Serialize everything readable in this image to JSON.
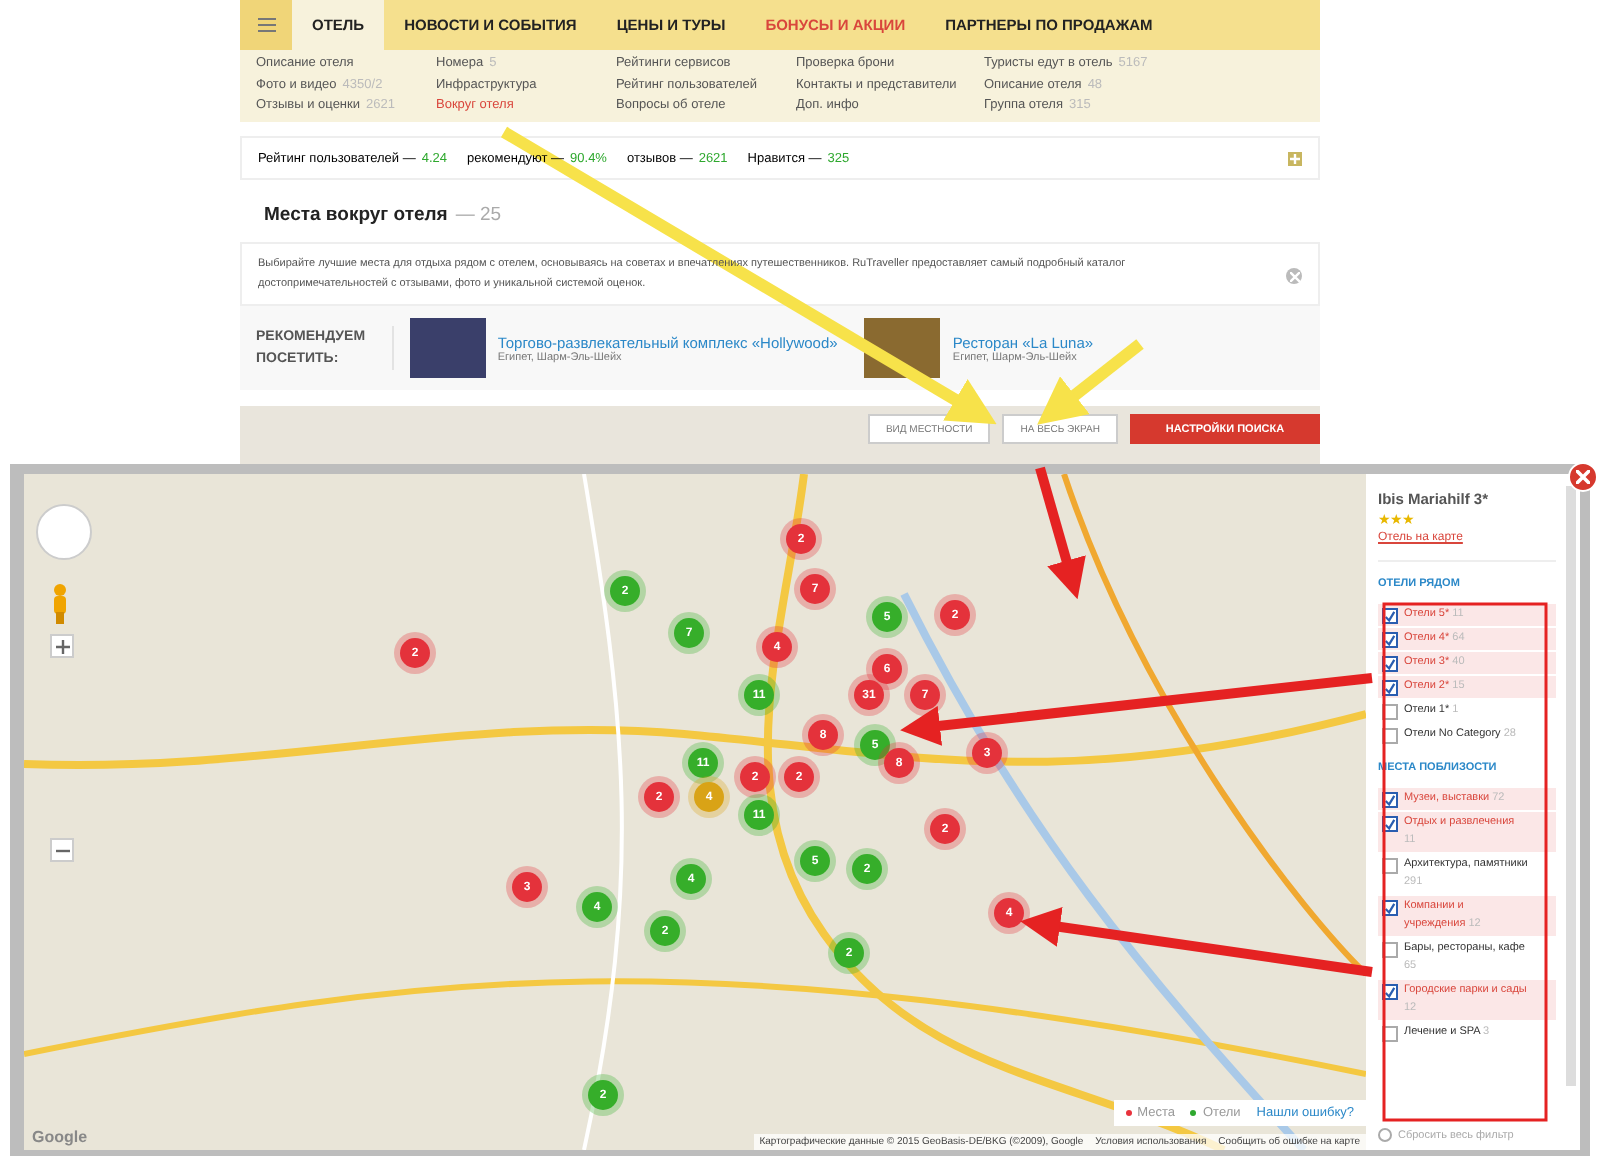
{
  "nav": {
    "tabs": [
      {
        "label": "ОТЕЛЬ",
        "selected": true,
        "kind": "normal"
      },
      {
        "label": "НОВОСТИ И СОБЫТИЯ",
        "selected": false,
        "kind": "normal"
      },
      {
        "label": "ЦЕНЫ И ТУРЫ",
        "selected": false,
        "kind": "normal"
      },
      {
        "label": "БОНУСЫ И АКЦИИ",
        "selected": false,
        "kind": "promo"
      },
      {
        "label": "ПАРТНЕРЫ ПО ПРОДАЖАМ",
        "selected": false,
        "kind": "normal"
      }
    ]
  },
  "submenu": {
    "columns": [
      [
        {
          "label": "Описание отеля",
          "selected": false
        },
        {
          "label": "Фото и видео",
          "count": "4350/2",
          "selected": false
        },
        {
          "label": "Отзывы и оценки",
          "count": "2621",
          "selected": false
        }
      ],
      [
        {
          "label": "Номера",
          "count": "5",
          "selected": false
        },
        {
          "label": "Инфраструктура",
          "selected": false
        },
        {
          "label": "Вокруг отеля",
          "selected": true
        }
      ],
      [
        {
          "label": "Рейтинги сервисов",
          "selected": false
        },
        {
          "label": "Рейтинг пользователей",
          "selected": false
        },
        {
          "label": "Вопросы об отеле",
          "selected": false
        }
      ],
      [
        {
          "label": "Проверка брони",
          "selected": false
        },
        {
          "label": "Контакты и представители",
          "selected": false
        },
        {
          "label": "Доп. инфо",
          "selected": false
        }
      ],
      [
        {
          "label": "Туристы едут в отель",
          "count": "5167",
          "selected": false
        },
        {
          "label": "Описание отеля",
          "count": "48",
          "selected": false
        },
        {
          "label": "Группа отеля",
          "count": "315",
          "selected": false
        }
      ]
    ]
  },
  "rating_bar": {
    "items": [
      {
        "label": "Рейтинг пользователей —",
        "value": "4.24"
      },
      {
        "label": "рекомендуют —",
        "value": "90.4%"
      },
      {
        "label": "отзывов —",
        "value": "2621"
      },
      {
        "label": "Нравится —",
        "value": "325"
      }
    ]
  },
  "section": {
    "title": "Места вокруг отеля",
    "count": "— 25"
  },
  "info": {
    "text": "Выбирайте лучшие места для отдыха рядом с отелем, основываясь на советах и впечатлениях путешественников. RuTraveller предоставляет самый подробный каталог достопримечательностей с отзывами, фото и уникальной системой оценок."
  },
  "recommend": {
    "label": "РЕКОМЕНДУЕМ ПОСЕТИТЬ:",
    "items": [
      {
        "title": "Торгово-развлекательный комплекс «Hollywood»",
        "location": "Египет, Шарм-Эль-Шейх"
      },
      {
        "title": "Ресторан «La Luna»",
        "location": "Египет, Шарм-Эль-Шейх"
      }
    ]
  },
  "map_strip": {
    "buttons": [
      "ВИД МЕСТНОСТИ",
      "НА ВЕСЬ ЭКРАН"
    ],
    "settings": "НАСТРОЙКИ ПОИСКА"
  },
  "modal": {
    "map": {
      "clusters": [
        {
          "count": "2",
          "kind": "place"
        },
        {
          "count": "2",
          "kind": "hotel"
        },
        {
          "count": "7",
          "kind": "place"
        },
        {
          "count": "5",
          "kind": "hotel"
        },
        {
          "count": "2",
          "kind": "place"
        },
        {
          "count": "7",
          "kind": "hotel"
        },
        {
          "count": "4",
          "kind": "place"
        },
        {
          "count": "2",
          "kind": "place"
        },
        {
          "count": "6",
          "kind": "place"
        },
        {
          "count": "11",
          "kind": "hotel"
        },
        {
          "count": "31",
          "kind": "place"
        },
        {
          "count": "7",
          "kind": "place"
        },
        {
          "count": "8",
          "kind": "place"
        },
        {
          "count": "5",
          "kind": "hotel"
        },
        {
          "count": "3",
          "kind": "place"
        },
        {
          "count": "11",
          "kind": "hotel"
        },
        {
          "count": "8",
          "kind": "place"
        },
        {
          "count": "2",
          "kind": "place"
        },
        {
          "count": "2",
          "kind": "place"
        },
        {
          "count": "2",
          "kind": "place"
        },
        {
          "count": "4",
          "kind": "mixed"
        },
        {
          "count": "11",
          "kind": "hotel"
        },
        {
          "count": "2",
          "kind": "place"
        },
        {
          "count": "5",
          "kind": "hotel"
        },
        {
          "count": "2",
          "kind": "hotel"
        },
        {
          "count": "4",
          "kind": "hotel"
        },
        {
          "count": "3",
          "kind": "place"
        },
        {
          "count": "4",
          "kind": "hotel"
        },
        {
          "count": "4",
          "kind": "place"
        },
        {
          "count": "2",
          "kind": "hotel"
        },
        {
          "count": "2",
          "kind": "hotel"
        },
        {
          "count": "2",
          "kind": "hotel"
        }
      ],
      "legend": [
        {
          "label": "Места",
          "color": "#e8323c"
        },
        {
          "label": "Отели",
          "color": "#2ea82e"
        }
      ],
      "report_link": "Нашли ошибку?",
      "logo": "Google",
      "attribution": "Картографические данные © 2015 GeoBasis-DE/BKG (©2009), Google",
      "terms": "Условия использования",
      "report_map": "Сообщить об ошибке на карте"
    },
    "sidebar": {
      "hotel": "Ibis Mariahilf 3*",
      "stars": 3,
      "map_link": "Отель на карте",
      "groups": [
        {
          "title": "ОТЕЛИ РЯДОМ",
          "items": [
            {
              "label": "Отели 5*",
              "count": "11",
              "checked": true
            },
            {
              "label": "Отели 4*",
              "count": "64",
              "checked": true
            },
            {
              "label": "Отели 3*",
              "count": "40",
              "checked": true
            },
            {
              "label": "Отели 2*",
              "count": "15",
              "checked": true
            },
            {
              "label": "Отели 1*",
              "count": "1",
              "checked": false
            },
            {
              "label": "Отели No Category",
              "count": "28",
              "checked": false
            }
          ]
        },
        {
          "title": "МЕСТА ПОБЛИЗОСТИ",
          "items": [
            {
              "label": "Музеи, выставки",
              "count": "72",
              "checked": true
            },
            {
              "label": "Отдых и развлечения",
              "count": "11",
              "checked": true
            },
            {
              "label": "Архитектура, памятники",
              "count": "291",
              "checked": false
            },
            {
              "label": "Компании и учреждения",
              "count": "12",
              "checked": true
            },
            {
              "label": "Бары, рестораны, кафе",
              "count": "65",
              "checked": false
            },
            {
              "label": "Городские парки и сады",
              "count": "12",
              "checked": true
            },
            {
              "label": "Лечение и SPA",
              "count": "3",
              "checked": false
            }
          ]
        }
      ],
      "reset": "Сбросить весь фильтр"
    }
  }
}
